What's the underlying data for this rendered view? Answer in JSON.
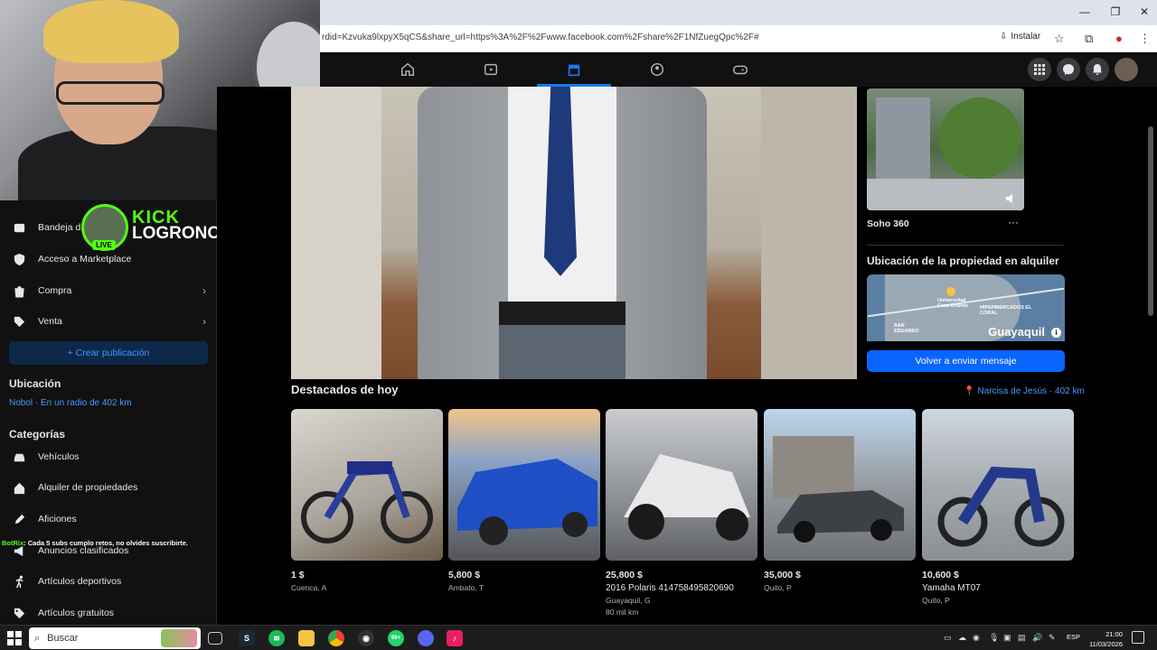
{
  "browser": {
    "url": "rdid=Kzvuka9lxpyX5qCS&share_url=https%3A%2F%2Fwww.facebook.com%2Fshare%2F1NfZuegQpc%2F#",
    "install_label": "Instalar"
  },
  "kick_overlay": {
    "brand": "KICK",
    "username": "LOGRONOL",
    "live_badge": "LIVE",
    "chat_user": "BotRix",
    "chat_message": ": Cada 5 subs cumplo retos, no olvides suscribirte."
  },
  "sidebar": {
    "items_top": [
      {
        "label": "Bandeja d",
        "icon": "inbox-icon"
      },
      {
        "label": "Acceso a Marketplace",
        "icon": "shield-icon"
      },
      {
        "label": "Compra",
        "icon": "bag-icon"
      },
      {
        "label": "Venta",
        "icon": "tag-icon"
      }
    ],
    "create_button": "+ Crear publicación",
    "location_heading": "Ubicación",
    "location_value": "Nobol · En un radio de 402 km",
    "categories_heading": "Categorías",
    "categories": [
      {
        "label": "Vehículos",
        "icon": "car-icon"
      },
      {
        "label": "Alquiler de propiedades",
        "icon": "house-icon"
      },
      {
        "label": "Aficiones",
        "icon": "pen-icon"
      },
      {
        "label": "Anuncios clasificados",
        "icon": "megaphone-icon"
      },
      {
        "label": "Artículos deportivos",
        "icon": "running-icon"
      },
      {
        "label": "Artículos gratuitos",
        "icon": "tag-icon"
      }
    ]
  },
  "listing": {
    "title": "Soho 360",
    "more": "···",
    "location_heading": "Ubicación de la propiedad en alquiler",
    "map_city": "Guayaquil",
    "map_labels": [
      "Universidad Casa Grande",
      "HIPERMERCADOS EL CORAL",
      "SAN EDUARDO"
    ],
    "send_button": "Volver a enviar mensaje"
  },
  "featured": {
    "title": "Destacados de hoy",
    "location": "Narcisa de Jesús · 402 km",
    "items": [
      {
        "price": "1 $",
        "name": "",
        "location": "Cuenca, A",
        "extra": ""
      },
      {
        "price": "5,800 $",
        "name": "",
        "location": "Ambato, T",
        "extra": ""
      },
      {
        "price": "25,800 $",
        "name": "2016 Polaris 414758495820690",
        "location": "Guayaquil, G",
        "extra": "80 mil km"
      },
      {
        "price": "35,000 $",
        "name": "",
        "location": "Quito, P",
        "extra": ""
      },
      {
        "price": "10,600 $",
        "name": "Yamaha MT07",
        "location": "Quito, P",
        "extra": ""
      }
    ]
  },
  "taskbar": {
    "search_placeholder": "Buscar",
    "whatsapp_badge": "99+",
    "language": "ESP",
    "time": "21:00",
    "date": "11/03/2026"
  },
  "colors": {
    "accent": "#1877f2",
    "kick_green": "#53fc18",
    "link_blue": "#4599ff"
  }
}
